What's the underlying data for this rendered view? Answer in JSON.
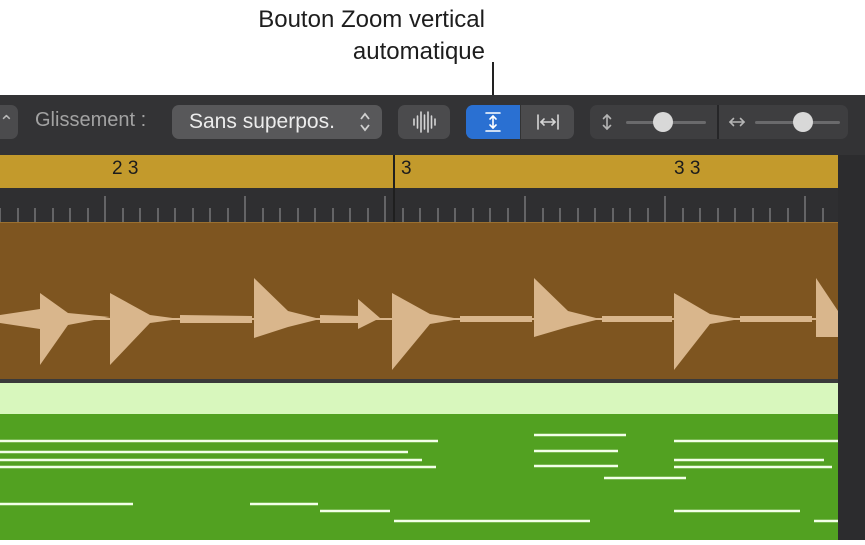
{
  "callout": {
    "line1": "Bouton Zoom vertical",
    "line2": "automatique"
  },
  "toolbar": {
    "edge_chevron": "⌃",
    "drag_label": "Glissement :",
    "drag_value": "Sans superpos.",
    "waveform_icon": "waveform-zoom-icon",
    "auto_zoom_vertical_icon": "vertical-zoom-icon",
    "auto_zoom_horizontal_icon": "horizontal-zoom-icon",
    "vertical_zoom_level": 0.45,
    "horizontal_zoom_level": 0.6,
    "accent_color": "#2a70d2"
  },
  "ruler": {
    "markers": [
      "2 3",
      "3",
      "3 3"
    ],
    "color": "#c39a2c"
  },
  "regions": {
    "audio_color": "#7e5520",
    "waveform_color": "#d9b68c",
    "midi_color": "#52a121",
    "midi_header_color": "#d8f7bd",
    "note_color": "#f2ffe8"
  }
}
